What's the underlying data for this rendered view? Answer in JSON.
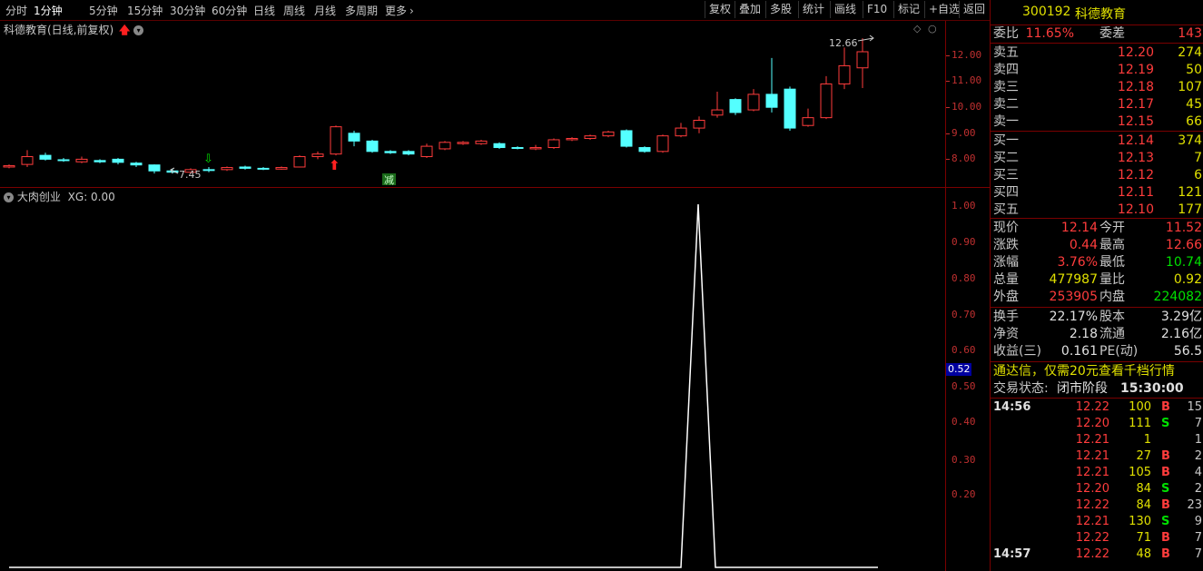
{
  "toolbar": {
    "periods": [
      "分时",
      "1分钟",
      "5分钟",
      "15分钟",
      "30分钟",
      "60分钟",
      "日线",
      "周线",
      "月线",
      "多周期",
      "更多"
    ],
    "more_icon": "chevron-right-icon",
    "right_buttons": [
      "复权",
      "叠加",
      "多股",
      "统计",
      "画线",
      "F10",
      "标记",
      "+自选",
      "返回"
    ]
  },
  "main_chart": {
    "title": "科德教育(日线,前复权)",
    "high_label": "12.66",
    "low_label": "7.45",
    "reduce_label": "减",
    "axis_ticks": [
      "12.00",
      "11.00",
      "10.00",
      "9.00",
      "8.00"
    ]
  },
  "indicator": {
    "title": "大肉创业",
    "xg_label": "XG: 0.00",
    "axis_ticks": [
      "1.00",
      "0.90",
      "0.80",
      "0.70",
      "0.60",
      "0.50",
      "0.40",
      "0.30",
      "0.20"
    ],
    "current_value": "0.52"
  },
  "quote": {
    "code": "300192",
    "name": "科德教育",
    "weibi_label": "委比",
    "weibi_value": "11.65%",
    "weicha_label": "委差",
    "weicha_value": "143",
    "asks": [
      {
        "label": "卖五",
        "price": "12.20",
        "vol": "274"
      },
      {
        "label": "卖四",
        "price": "12.19",
        "vol": "50"
      },
      {
        "label": "卖三",
        "price": "12.18",
        "vol": "107"
      },
      {
        "label": "卖二",
        "price": "12.17",
        "vol": "45"
      },
      {
        "label": "卖一",
        "price": "12.15",
        "vol": "66"
      }
    ],
    "bids": [
      {
        "label": "买一",
        "price": "12.14",
        "vol": "374"
      },
      {
        "label": "买二",
        "price": "12.13",
        "vol": "7"
      },
      {
        "label": "买三",
        "price": "12.12",
        "vol": "6"
      },
      {
        "label": "买四",
        "price": "12.11",
        "vol": "121"
      },
      {
        "label": "买五",
        "price": "12.10",
        "vol": "177"
      }
    ],
    "stats": [
      {
        "l1": "现价",
        "v1": "12.14",
        "c1": "red",
        "l2": "今开",
        "v2": "11.52",
        "c2": "red"
      },
      {
        "l1": "涨跌",
        "v1": "0.44",
        "c1": "red",
        "l2": "最高",
        "v2": "12.66",
        "c2": "red"
      },
      {
        "l1": "涨幅",
        "v1": "3.76%",
        "c1": "red",
        "l2": "最低",
        "v2": "10.74",
        "c2": "green"
      },
      {
        "l1": "总量",
        "v1": "477987",
        "c1": "yellow",
        "l2": "量比",
        "v2": "0.92",
        "c2": "yellow"
      },
      {
        "l1": "外盘",
        "v1": "253905",
        "c1": "red",
        "l2": "内盘",
        "v2": "224082",
        "c2": "green"
      }
    ],
    "stats2": [
      {
        "l1": "换手",
        "v1": "22.17%",
        "l2": "股本",
        "v2": "3.29亿"
      },
      {
        "l1": "净资",
        "v1": "2.18",
        "l2": "流通",
        "v2": "2.16亿"
      },
      {
        "l1": "收益(三)",
        "v1": "0.161",
        "l2": "PE(动)",
        "v2": "56.5"
      }
    ],
    "promo": "通达信，仅需20元查看千档行情",
    "status_label": "交易状态:",
    "status_value": "闭市阶段",
    "status_time": "15:30:00"
  },
  "trades": [
    {
      "time": "14:56",
      "price": "12.22",
      "vol": "100",
      "bs": "B",
      "n": "15"
    },
    {
      "time": "",
      "price": "12.20",
      "vol": "111",
      "bs": "S",
      "n": "7"
    },
    {
      "time": "",
      "price": "12.21",
      "vol": "1",
      "bs": "",
      "n": "1"
    },
    {
      "time": "",
      "price": "12.21",
      "vol": "27",
      "bs": "B",
      "n": "2"
    },
    {
      "time": "",
      "price": "12.21",
      "vol": "105",
      "bs": "B",
      "n": "4"
    },
    {
      "time": "",
      "price": "12.20",
      "vol": "84",
      "bs": "S",
      "n": "2"
    },
    {
      "time": "",
      "price": "12.22",
      "vol": "84",
      "bs": "B",
      "n": "23"
    },
    {
      "time": "",
      "price": "12.21",
      "vol": "130",
      "bs": "S",
      "n": "9"
    },
    {
      "time": "",
      "price": "12.22",
      "vol": "71",
      "bs": "B",
      "n": "7"
    },
    {
      "time": "14:57",
      "price": "12.22",
      "vol": "48",
      "bs": "B",
      "n": "7"
    }
  ],
  "colors": {
    "up": "#ff3c3c",
    "down": "#54ffff",
    "frame": "#7a0000",
    "axis": "#c03030"
  },
  "candles": [
    {
      "o": 7.7,
      "c": 7.75,
      "h": 7.8,
      "l": 7.65
    },
    {
      "o": 7.8,
      "c": 8.1,
      "h": 8.35,
      "l": 7.7
    },
    {
      "o": 8.15,
      "c": 8.0,
      "h": 8.25,
      "l": 7.95
    },
    {
      "o": 7.98,
      "c": 7.95,
      "h": 8.05,
      "l": 7.9
    },
    {
      "o": 7.9,
      "c": 8.0,
      "h": 8.1,
      "l": 7.85
    },
    {
      "o": 7.95,
      "c": 7.9,
      "h": 8.0,
      "l": 7.85
    },
    {
      "o": 8.0,
      "c": 7.88,
      "h": 8.05,
      "l": 7.8
    },
    {
      "o": 7.85,
      "c": 7.78,
      "h": 7.9,
      "l": 7.7
    },
    {
      "o": 7.78,
      "c": 7.55,
      "h": 7.8,
      "l": 7.45
    },
    {
      "o": 7.55,
      "c": 7.5,
      "h": 7.62,
      "l": 7.45
    },
    {
      "o": 7.5,
      "c": 7.6,
      "h": 7.65,
      "l": 7.45
    },
    {
      "o": 7.6,
      "c": 7.58,
      "h": 7.7,
      "l": 7.5
    },
    {
      "o": 7.6,
      "c": 7.68,
      "h": 7.72,
      "l": 7.55
    },
    {
      "o": 7.7,
      "c": 7.65,
      "h": 7.75,
      "l": 7.6
    },
    {
      "o": 7.65,
      "c": 7.62,
      "h": 7.7,
      "l": 7.58
    },
    {
      "o": 7.62,
      "c": 7.68,
      "h": 7.72,
      "l": 7.6
    },
    {
      "o": 7.7,
      "c": 8.1,
      "h": 8.15,
      "l": 7.68
    },
    {
      "o": 8.1,
      "c": 8.2,
      "h": 8.3,
      "l": 8.0
    },
    {
      "o": 8.2,
      "c": 9.25,
      "h": 9.3,
      "l": 8.15
    },
    {
      "o": 9.0,
      "c": 8.7,
      "h": 9.1,
      "l": 8.5
    },
    {
      "o": 8.7,
      "c": 8.3,
      "h": 8.75,
      "l": 8.25
    },
    {
      "o": 8.3,
      "c": 8.25,
      "h": 8.35,
      "l": 8.2
    },
    {
      "o": 8.3,
      "c": 8.2,
      "h": 8.35,
      "l": 8.15
    },
    {
      "o": 8.1,
      "c": 8.5,
      "h": 8.6,
      "l": 8.05
    },
    {
      "o": 8.4,
      "c": 8.65,
      "h": 8.7,
      "l": 8.35
    },
    {
      "o": 8.6,
      "c": 8.65,
      "h": 8.7,
      "l": 8.55
    },
    {
      "o": 8.6,
      "c": 8.7,
      "h": 8.75,
      "l": 8.55
    },
    {
      "o": 8.6,
      "c": 8.45,
      "h": 8.65,
      "l": 8.4
    },
    {
      "o": 8.45,
      "c": 8.42,
      "h": 8.5,
      "l": 8.38
    },
    {
      "o": 8.4,
      "c": 8.45,
      "h": 8.55,
      "l": 8.35
    },
    {
      "o": 8.45,
      "c": 8.75,
      "h": 8.8,
      "l": 8.4
    },
    {
      "o": 8.75,
      "c": 8.8,
      "h": 8.85,
      "l": 8.7
    },
    {
      "o": 8.8,
      "c": 8.9,
      "h": 8.95,
      "l": 8.75
    },
    {
      "o": 8.9,
      "c": 9.05,
      "h": 9.1,
      "l": 8.85
    },
    {
      "o": 9.1,
      "c": 8.5,
      "h": 9.15,
      "l": 8.45
    },
    {
      "o": 8.45,
      "c": 8.3,
      "h": 8.5,
      "l": 8.25
    },
    {
      "o": 8.3,
      "c": 8.9,
      "h": 8.95,
      "l": 8.25
    },
    {
      "o": 8.9,
      "c": 9.2,
      "h": 9.4,
      "l": 8.85
    },
    {
      "o": 9.2,
      "c": 9.5,
      "h": 9.65,
      "l": 9.0
    },
    {
      "o": 9.7,
      "c": 9.9,
      "h": 10.6,
      "l": 9.6
    },
    {
      "o": 10.3,
      "c": 9.8,
      "h": 10.35,
      "l": 9.7
    },
    {
      "o": 9.9,
      "c": 10.5,
      "h": 10.7,
      "l": 9.85
    },
    {
      "o": 10.5,
      "c": 10.0,
      "h": 11.9,
      "l": 9.8
    },
    {
      "o": 10.7,
      "c": 9.2,
      "h": 10.8,
      "l": 9.1
    },
    {
      "o": 9.3,
      "c": 9.6,
      "h": 9.95,
      "l": 9.25
    },
    {
      "o": 9.6,
      "c": 10.9,
      "h": 11.2,
      "l": 9.55
    },
    {
      "o": 10.9,
      "c": 11.6,
      "h": 12.3,
      "l": 10.7
    },
    {
      "o": 11.52,
      "c": 12.14,
      "h": 12.66,
      "l": 10.74
    }
  ]
}
